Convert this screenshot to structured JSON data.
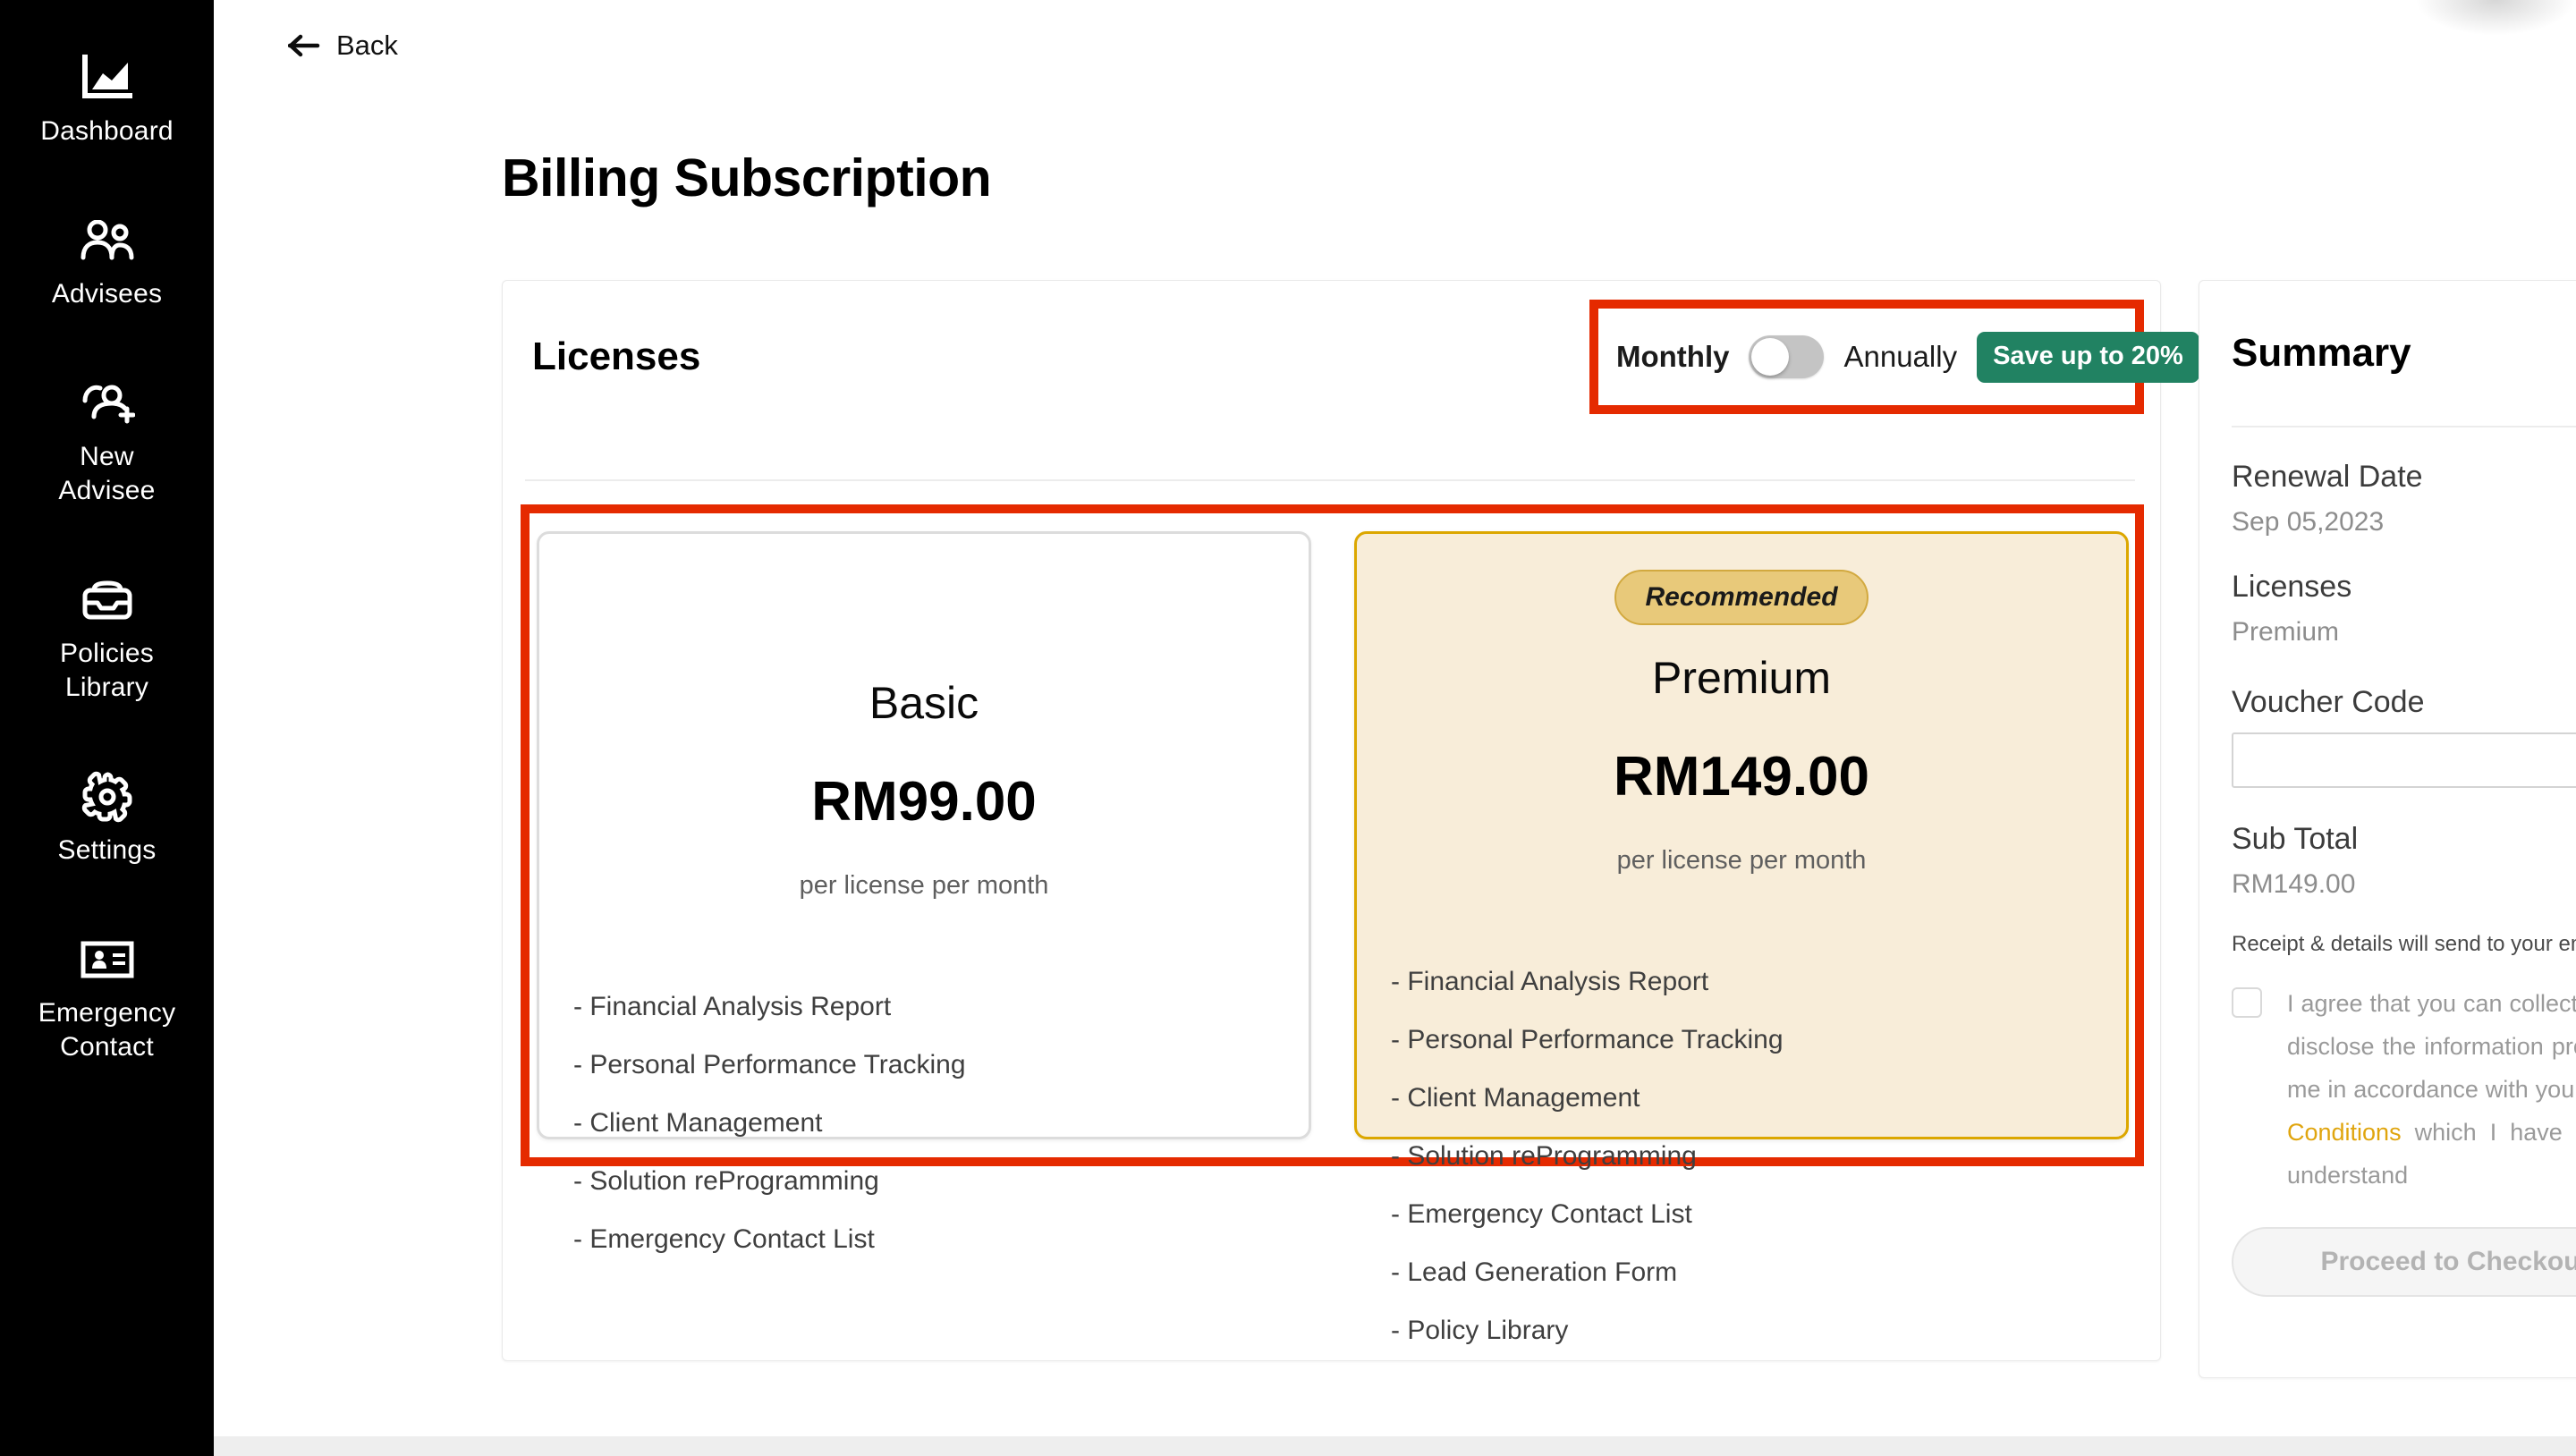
{
  "sidebar": {
    "items": [
      {
        "label": "Dashboard",
        "label2": "",
        "icon": "chart-icon"
      },
      {
        "label": "Advisees",
        "label2": "",
        "icon": "people-icon"
      },
      {
        "label": "New",
        "label2": "Advisee",
        "icon": "person-add-icon"
      },
      {
        "label": "Policies",
        "label2": "Library",
        "icon": "inbox-icon"
      },
      {
        "label": "Settings",
        "label2": "",
        "icon": "gear-icon"
      },
      {
        "label": "Emergency",
        "label2": "Contact",
        "icon": "contact-card-icon"
      }
    ]
  },
  "header": {
    "back_label": "Back",
    "page_title": "Billing Subscription"
  },
  "licenses": {
    "title": "Licenses",
    "billing_toggle": {
      "monthly_label": "Monthly",
      "annually_label": "Annually",
      "save_badge": "Save up to 20%",
      "selected": "Monthly"
    },
    "plans": [
      {
        "name": "Basic",
        "price": "RM99.00",
        "per": "per license per month",
        "recommended": false,
        "features": [
          "- Financial Analysis Report",
          "- Personal Performance Tracking",
          "- Client Management",
          "- Solution reProgramming",
          "- Emergency Contact List"
        ]
      },
      {
        "name": "Premium",
        "price": "RM149.00",
        "per": "per license per month",
        "recommended": true,
        "recommended_label": "Recommended",
        "features": [
          "- Financial Analysis Report",
          "- Personal Performance Tracking",
          "- Client Management",
          "- Solution reProgramming",
          "- Emergency Contact List",
          "- Lead Generation Form",
          "- Policy Library"
        ]
      }
    ]
  },
  "summary": {
    "title": "Summary",
    "renewal_date_label": "Renewal Date",
    "renewal_date_value": "Sep 05,2023",
    "licenses_label": "Licenses",
    "licenses_value": "Premium",
    "voucher_label": "Voucher Code",
    "voucher_value": "",
    "voucher_placeholder": "",
    "subtotal_label": "Sub Total",
    "subtotal_value": "RM149.00",
    "receipt_note": "Receipt & details will send to your email",
    "consent_text_part1": "I agree that you can collect, use and disclose the information provided by me in accordance with your ",
    "consent_terms_link": "Terms & Conditions",
    "consent_text_part2": " which I have read and understand",
    "consent_checked": false,
    "checkout_label": "Proceed to Checkout"
  },
  "annotations": {
    "highlight_color": "#E52A00",
    "boxes": [
      "billing-toggle",
      "plan-cards"
    ]
  },
  "colors": {
    "sidebar_bg": "#000000",
    "accent_gold": "#dca700",
    "premium_bg": "#f8edd9",
    "save_badge_green": "#218262",
    "terms_link": "#E0A50E",
    "annotation_red": "#E52A00"
  }
}
